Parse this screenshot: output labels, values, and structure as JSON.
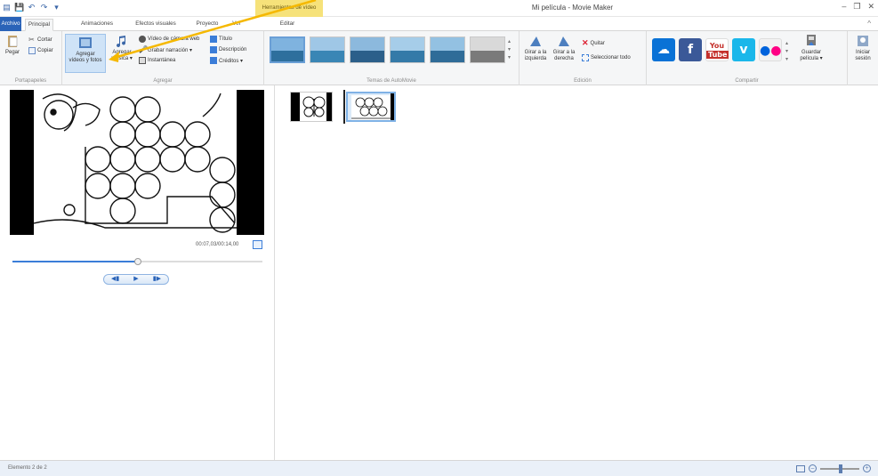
{
  "window": {
    "title": "Mi película - Movie Maker",
    "context_tab_header": "Herramientas de vídeo",
    "controls": [
      "–",
      "❐",
      "✕"
    ]
  },
  "tabs": [
    {
      "label": "Archivo"
    },
    {
      "label": "Principal"
    },
    {
      "label": "Animaciones"
    },
    {
      "label": "Efectos visuales"
    },
    {
      "label": "Proyecto"
    },
    {
      "label": "Ver"
    },
    {
      "label": "Editar"
    }
  ],
  "ribbon": {
    "clipboard": {
      "paste": "Pegar",
      "cut": "Cortar",
      "copy": "Copiar",
      "label": "Portapapeles"
    },
    "add": {
      "add_videos_line1": "Agregar",
      "add_videos_line2": "vídeos y fotos",
      "add_music_line1": "Agregar",
      "add_music_line2": "música ▾",
      "webcam": "Vídeo de cámara web",
      "narration": "Grabar narración ▾",
      "snapshot": "Instantánea",
      "title": "Título",
      "caption": "Descripción",
      "credits": "Créditos ▾",
      "label": "Agregar"
    },
    "themes": {
      "label": "Temas de AutoMovie"
    },
    "edit": {
      "rotate_left_line1": "Girar a la",
      "rotate_left_line2": "izquierda",
      "rotate_right_line1": "Girar a la",
      "rotate_right_line2": "derecha",
      "remove": "Quitar",
      "select_all": "Seleccionar todo",
      "label": "Edición"
    },
    "share": {
      "save_line1": "Guardar",
      "save_line2": "película ▾",
      "label": "Compartir"
    },
    "signin": {
      "line1": "Iniciar",
      "line2": "sesión"
    }
  },
  "player": {
    "timecode": "00:07,03/00:14,00",
    "progress": 0.5,
    "buttons": [
      "◀▮",
      "▶",
      "▮▶"
    ]
  },
  "status": {
    "text": "Elemento 2 de 2"
  },
  "colors": {
    "file_tab": "#2a63b8",
    "context_tab": "#f6e27a",
    "annotation_arrow": "#f5b800"
  }
}
